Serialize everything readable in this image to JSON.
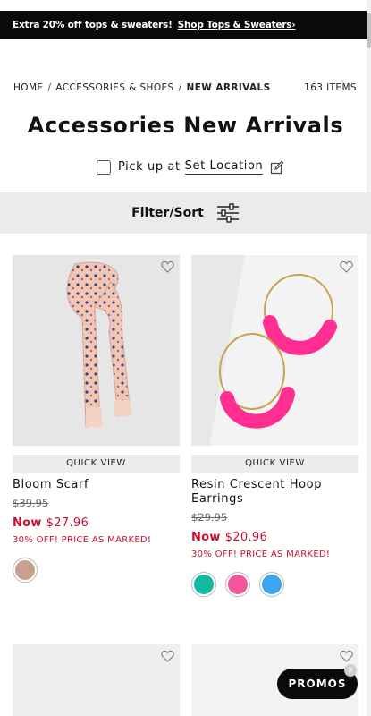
{
  "promo_bar": {
    "text": "Extra 20% off tops & sweaters!",
    "link": "Shop Tops & Sweaters›"
  },
  "breadcrumb": {
    "items": [
      "HOME",
      "ACCESSORIES & SHOES",
      "NEW ARRIVALS"
    ],
    "separator": "/"
  },
  "item_count": "163 ITEMS",
  "page_title": "Accessories New Arrivals",
  "pickup": {
    "label": "Pick up at",
    "location": "Set Location"
  },
  "filter": {
    "label": "Filter/Sort"
  },
  "products": [
    {
      "quick_view": "QUICK VIEW",
      "name": "Bloom Scarf",
      "was": "$39.95",
      "now_label": "Now",
      "now_price": "$27.96",
      "offer": "30% OFF! PRICE AS MARKED!",
      "swatches": [
        "#c9a090"
      ]
    },
    {
      "quick_view": "QUICK VIEW",
      "name": "Resin Crescent Hoop Earrings",
      "was": "$29.95",
      "now_label": "Now",
      "now_price": "$20.96",
      "offer": "30% OFF! PRICE AS MARKED!",
      "swatches": [
        "#10b9a0",
        "#f2559c",
        "#3aa7f0"
      ]
    }
  ],
  "promos_button": "PROMOS",
  "promos_close": "×",
  "colors": {
    "sale_red": "#c8102e",
    "promo_black": "#0a0a0a",
    "filter_bg": "#ebebeb"
  }
}
